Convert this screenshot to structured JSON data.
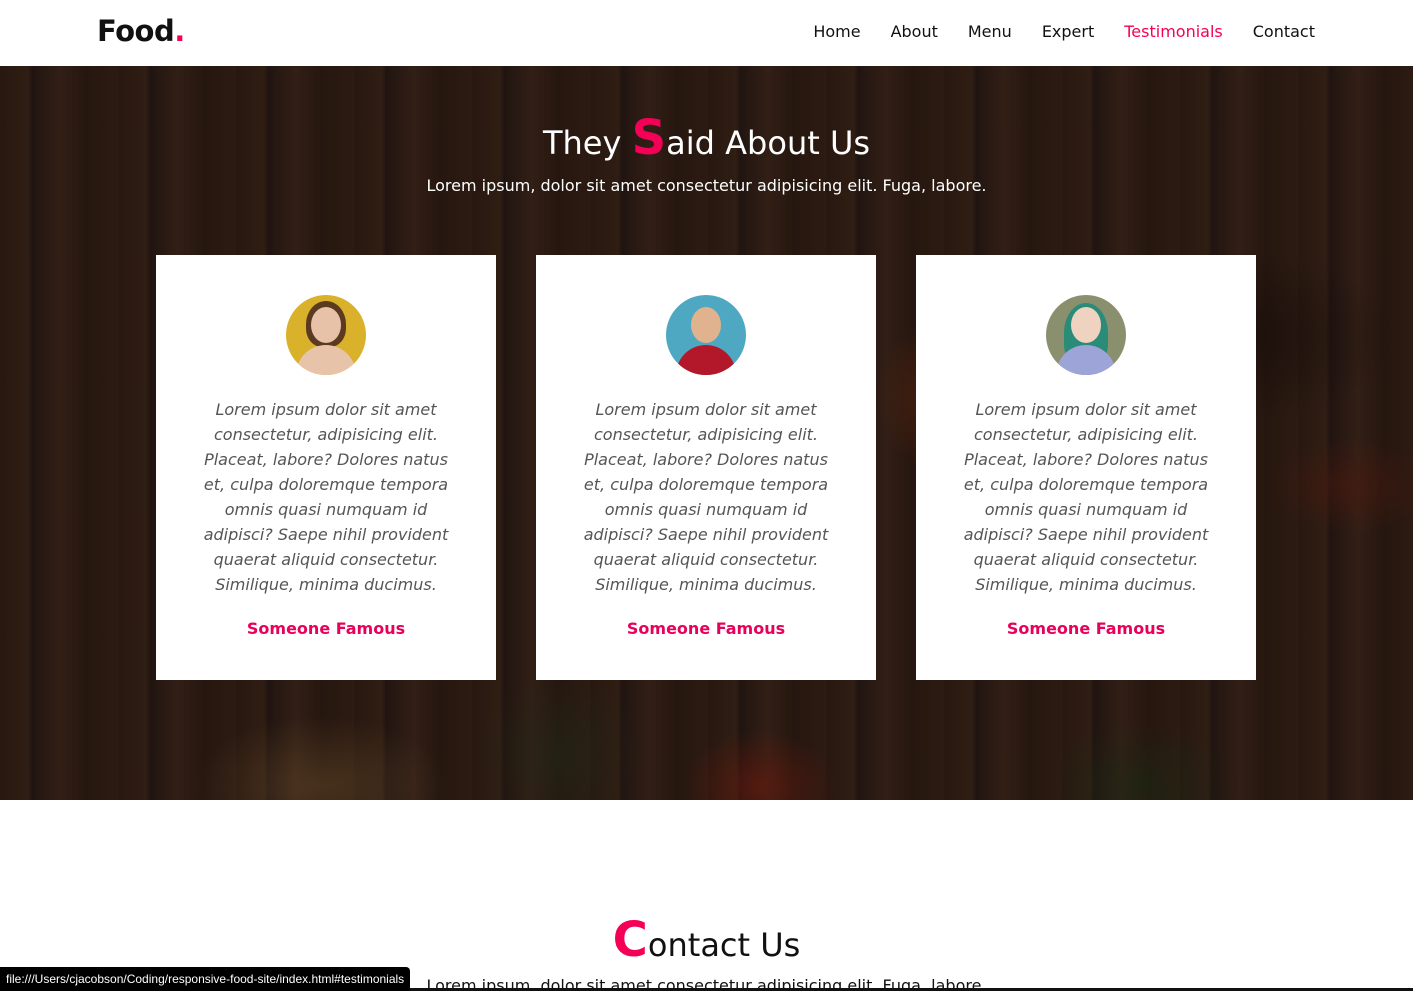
{
  "navbar": {
    "logo_text": "Food",
    "logo_dot": ".",
    "links": [
      {
        "label": "Home"
      },
      {
        "label": "About"
      },
      {
        "label": "Menu"
      },
      {
        "label": "Expert"
      },
      {
        "label": "Testimonials",
        "active": true
      },
      {
        "label": "Contact"
      }
    ]
  },
  "testimonials": {
    "title_first_letter": "S",
    "title_prefix": "They ",
    "title_rest": "aid About Us",
    "subtitle": "Lorem ipsum, dolor sit amet consectetur adipisicing elit. Fuga, labore.",
    "cards": [
      {
        "quote": "Lorem ipsum dolor sit amet consectetur, adipisicing elit. Placeat, labore? Dolores natus et, culpa doloremque tempora omnis quasi numquam id adipisci? Saepe nihil provident quaerat aliquid consectetur. Similique, minima ducimus.",
        "author": "Someone Famous"
      },
      {
        "quote": "Lorem ipsum dolor sit amet consectetur, adipisicing elit. Placeat, labore? Dolores natus et, culpa doloremque tempora omnis quasi numquam id adipisci? Saepe nihil provident quaerat aliquid consectetur. Similique, minima ducimus.",
        "author": "Someone Famous"
      },
      {
        "quote": "Lorem ipsum dolor sit amet consectetur, adipisicing elit. Placeat, labore? Dolores natus et, culpa doloremque tempora omnis quasi numquam id adipisci? Saepe nihil provident quaerat aliquid consectetur. Similique, minima ducimus.",
        "author": "Someone Famous"
      }
    ]
  },
  "contact": {
    "title_first_letter": "C",
    "title_rest": "ontact Us",
    "subtitle": "Lorem ipsum, dolor sit amet consectetur adipisicing elit. Fuga, labore."
  },
  "status_bar": {
    "url": "file:///Users/cjacobson/Coding/responsive-food-site/index.html#testimonials"
  },
  "colors": {
    "accent": "#f50057",
    "text": "#111111",
    "card_bg": "#ffffff"
  }
}
